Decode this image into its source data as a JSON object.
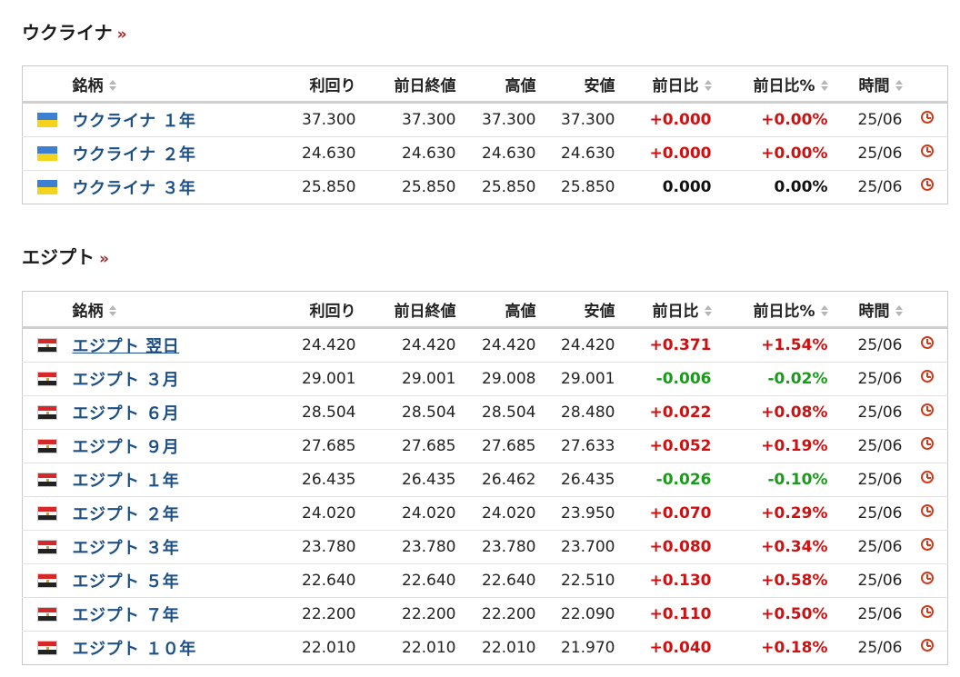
{
  "columns": {
    "name": "銘柄",
    "yield": "利回り",
    "prev_close": "前日終値",
    "high": "高値",
    "low": "安値",
    "change": "前日比",
    "change_pct": "前日比%",
    "time": "時間"
  },
  "colors": {
    "positive": "#d01010",
    "negative": "#1a9a1a",
    "link": "#1c4f86"
  },
  "sections": [
    {
      "title": "ウクライナ",
      "more": "»",
      "flag_icon": "ukraine-flag-icon",
      "rows": [
        {
          "name": "ウクライナ １年",
          "yield": "37.300",
          "prev_close": "37.300",
          "high": "37.300",
          "low": "37.300",
          "change": "+0.000",
          "change_pct": "+0.00%",
          "time": "25/06",
          "dir": "pos"
        },
        {
          "name": "ウクライナ ２年",
          "yield": "24.630",
          "prev_close": "24.630",
          "high": "24.630",
          "low": "24.630",
          "change": "+0.000",
          "change_pct": "+0.00%",
          "time": "25/06",
          "dir": "pos"
        },
        {
          "name": "ウクライナ ３年",
          "yield": "25.850",
          "prev_close": "25.850",
          "high": "25.850",
          "low": "25.850",
          "change": "0.000",
          "change_pct": "0.00%",
          "time": "25/06",
          "dir": "zero"
        }
      ]
    },
    {
      "title": "エジプト",
      "more": "»",
      "flag_icon": "egypt-flag-icon",
      "rows": [
        {
          "name": "エジプト 翌日",
          "yield": "24.420",
          "prev_close": "24.420",
          "high": "24.420",
          "low": "24.420",
          "change": "+0.371",
          "change_pct": "+1.54%",
          "time": "25/06",
          "dir": "pos",
          "underline": true
        },
        {
          "name": "エジプト ３月",
          "yield": "29.001",
          "prev_close": "29.001",
          "high": "29.008",
          "low": "29.001",
          "change": "-0.006",
          "change_pct": "-0.02%",
          "time": "25/06",
          "dir": "neg"
        },
        {
          "name": "エジプト ６月",
          "yield": "28.504",
          "prev_close": "28.504",
          "high": "28.504",
          "low": "28.480",
          "change": "+0.022",
          "change_pct": "+0.08%",
          "time": "25/06",
          "dir": "pos"
        },
        {
          "name": "エジプト ９月",
          "yield": "27.685",
          "prev_close": "27.685",
          "high": "27.685",
          "low": "27.633",
          "change": "+0.052",
          "change_pct": "+0.19%",
          "time": "25/06",
          "dir": "pos"
        },
        {
          "name": "エジプト １年",
          "yield": "26.435",
          "prev_close": "26.435",
          "high": "26.462",
          "low": "26.435",
          "change": "-0.026",
          "change_pct": "-0.10%",
          "time": "25/06",
          "dir": "neg"
        },
        {
          "name": "エジプト ２年",
          "yield": "24.020",
          "prev_close": "24.020",
          "high": "24.020",
          "low": "23.950",
          "change": "+0.070",
          "change_pct": "+0.29%",
          "time": "25/06",
          "dir": "pos"
        },
        {
          "name": "エジプト ３年",
          "yield": "23.780",
          "prev_close": "23.780",
          "high": "23.780",
          "low": "23.700",
          "change": "+0.080",
          "change_pct": "+0.34%",
          "time": "25/06",
          "dir": "pos"
        },
        {
          "name": "エジプト ５年",
          "yield": "22.640",
          "prev_close": "22.640",
          "high": "22.640",
          "low": "22.510",
          "change": "+0.130",
          "change_pct": "+0.58%",
          "time": "25/06",
          "dir": "pos"
        },
        {
          "name": "エジプト ７年",
          "yield": "22.200",
          "prev_close": "22.200",
          "high": "22.200",
          "low": "22.090",
          "change": "+0.110",
          "change_pct": "+0.50%",
          "time": "25/06",
          "dir": "pos"
        },
        {
          "name": "エジプト １０年",
          "yield": "22.010",
          "prev_close": "22.010",
          "high": "22.010",
          "low": "21.970",
          "change": "+0.040",
          "change_pct": "+0.18%",
          "time": "25/06",
          "dir": "pos"
        }
      ]
    }
  ]
}
